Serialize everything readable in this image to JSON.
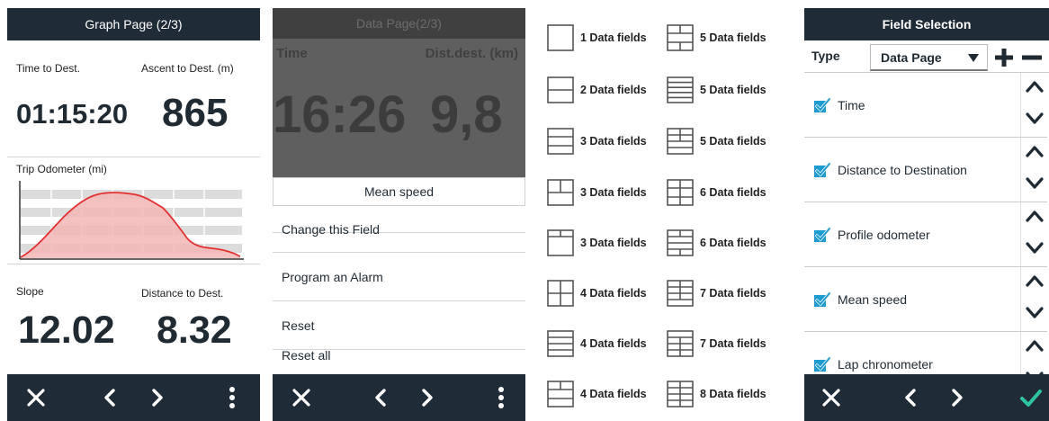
{
  "screen1": {
    "title": "Graph Page (2/3)",
    "time_label": "Time to Dest.",
    "time_value": "01:15:20",
    "ascent_label": "Ascent to Dest. (m)",
    "ascent_value": "865",
    "odometer_label": "Trip Odometer (mi)",
    "slope_label": "Slope",
    "slope_value": "12.02",
    "dist_label": "Distance to Dest.",
    "dist_value": "8.32",
    "profile_fill": "#f3b5b5",
    "profile_line": "#e23030"
  },
  "screen2": {
    "title": "Data Page(2/3)",
    "time_label": "Time",
    "time_value": "16:26",
    "dist_label": "Dist.dest. (km)",
    "dist_value": "9,8",
    "field_name": "Mean speed",
    "menu": [
      "Change this Field",
      "Program an Alarm",
      "Reset",
      "Reset all"
    ]
  },
  "layouts": {
    "left": [
      "1 Data fields",
      "2 Data fields",
      "3 Data fields",
      "3 Data fields",
      "3 Data fields",
      "4 Data fields",
      "4 Data fields",
      "4 Data fields"
    ],
    "right": [
      "5 Data fields",
      "5 Data fields",
      "5 Data fields",
      "6 Data fields",
      "6 Data fields",
      "7 Data fields",
      "7 Data fields",
      "8 Data fields"
    ]
  },
  "screen4": {
    "title": "Field Selection",
    "type_label": "Type",
    "type_value": "Data Page",
    "fields": [
      "Time",
      "Distance to Destination",
      "Profile odometer",
      "Mean speed",
      "Lap chronometer"
    ],
    "check_color": "#1e9bd0",
    "confirm_color": "#2ec4a0"
  },
  "icons": {
    "close": "close-icon",
    "back": "chevron-left-icon",
    "forward": "chevron-right-icon",
    "more": "more-vertical-icon",
    "confirm": "check-icon",
    "add": "plus-icon",
    "remove": "minus-icon",
    "move_up": "chevron-up-icon",
    "move_down": "chevron-down-icon",
    "dropdown": "caret-down-icon",
    "checkbox": "checkbox-checked-icon"
  }
}
